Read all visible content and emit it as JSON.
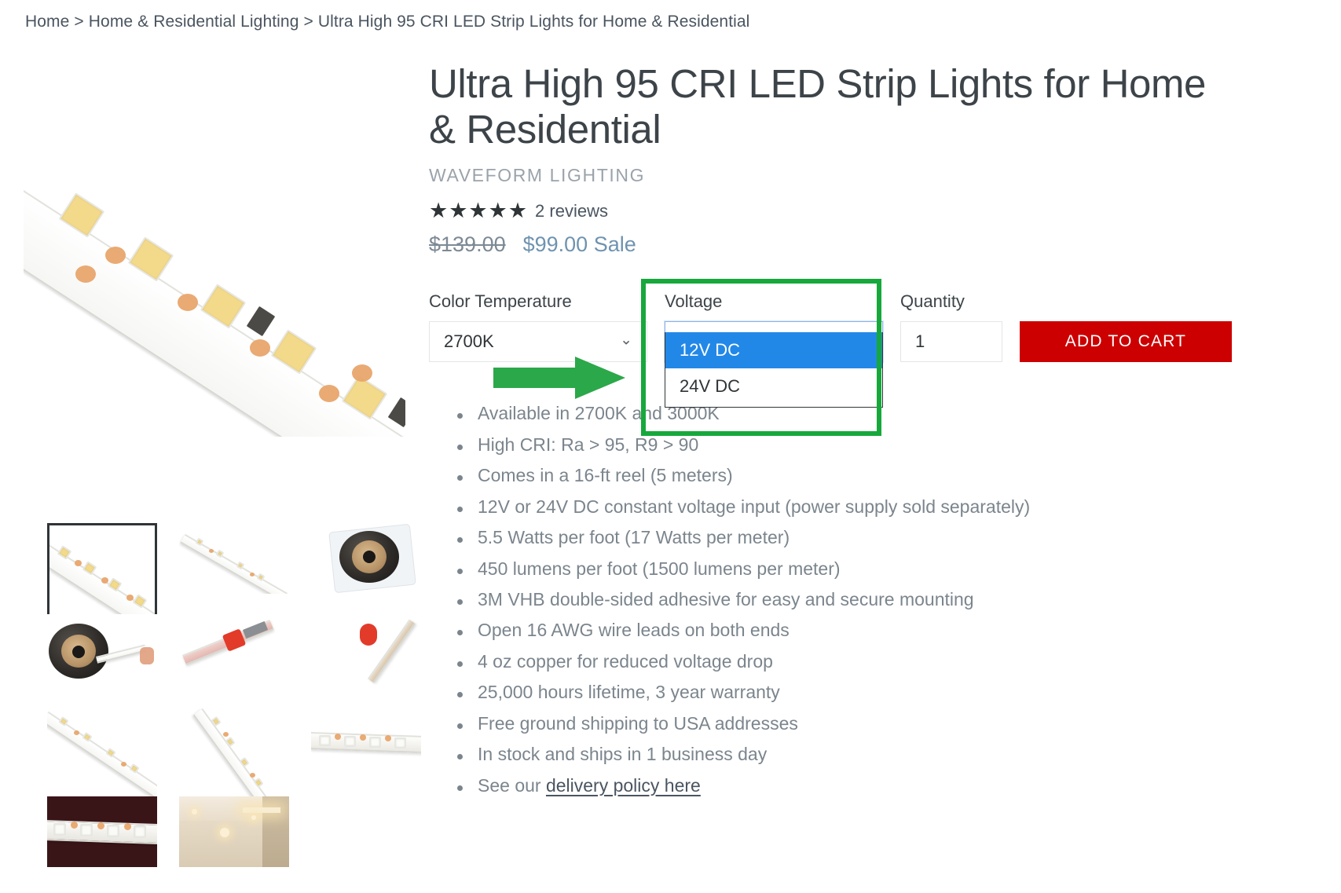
{
  "breadcrumb": {
    "items": [
      "Home",
      "Home & Residential Lighting",
      "Ultra High 95 CRI LED Strip Lights for Home & Residential"
    ],
    "separator": ">"
  },
  "product": {
    "title": "Ultra High 95 CRI LED Strip Lights for Home & Residential",
    "vendor": "WAVEFORM LIGHTING",
    "stars": "★★★★★",
    "reviews": "2 reviews",
    "price_old": "$139.00",
    "price_new": "$99.00",
    "price_sale_label": "Sale"
  },
  "options": {
    "color_temperature": {
      "label": "Color Temperature",
      "value": "2700K",
      "chevron": "chevron-down-icon"
    },
    "voltage": {
      "label": "Voltage",
      "value": "12V DC",
      "chevron": "chevron-down-icon",
      "open": true,
      "items": [
        {
          "label": "12V DC",
          "selected": true
        },
        {
          "label": "24V DC",
          "selected": false
        }
      ]
    },
    "quantity": {
      "label": "Quantity",
      "value": "1"
    },
    "add_to_cart": "ADD TO CART"
  },
  "features": [
    "Available in 2700K and 3000K",
    "High CRI: Ra > 95, R9 > 90",
    "Comes in a 16-ft reel (5 meters)",
    "12V or 24V DC constant voltage input (power supply sold separately)",
    "5.5 Watts per foot (17 Watts per meter)",
    "450 lumens per foot (1500 lumens per meter)",
    "3M VHB double-sided adhesive for easy and secure mounting",
    "Open 16 AWG wire leads on both ends",
    "4 oz copper for reduced voltage drop",
    "25,000 hours lifetime, 3 year warranty",
    "Free ground shipping to USA addresses",
    "In stock and ships in 1 business day"
  ],
  "delivery": {
    "prefix": "See our ",
    "link": "delivery policy here"
  },
  "gallery": {
    "hero_alt": "led-strip-closeup",
    "thumbs": [
      {
        "name": "thumb-strip-closeup",
        "selected": true
      },
      {
        "name": "thumb-strip-angled",
        "selected": false
      },
      {
        "name": "thumb-reel-in-bag",
        "selected": false
      },
      {
        "name": "thumb-reel-unrolled",
        "selected": false
      },
      {
        "name": "thumb-strip-red-connector",
        "selected": false
      },
      {
        "name": "thumb-strip-red-tape",
        "selected": false
      },
      {
        "name": "thumb-strip-diagonal",
        "selected": false
      },
      {
        "name": "thumb-strip-steep",
        "selected": false
      },
      {
        "name": "thumb-strip-lit",
        "selected": false
      },
      {
        "name": "thumb-strip-on-red",
        "selected": false
      },
      {
        "name": "thumb-room-install",
        "selected": false
      }
    ]
  },
  "annotation": {
    "box_color": "#17a83c",
    "arrow_color": "#2ba84a",
    "target": "voltage-dropdown"
  },
  "colors": {
    "add_to_cart_bg": "#cc0000",
    "dropdown_highlight": "#2288e8",
    "sale_text": "#6f93b0",
    "annotation_green": "#17a83c"
  }
}
